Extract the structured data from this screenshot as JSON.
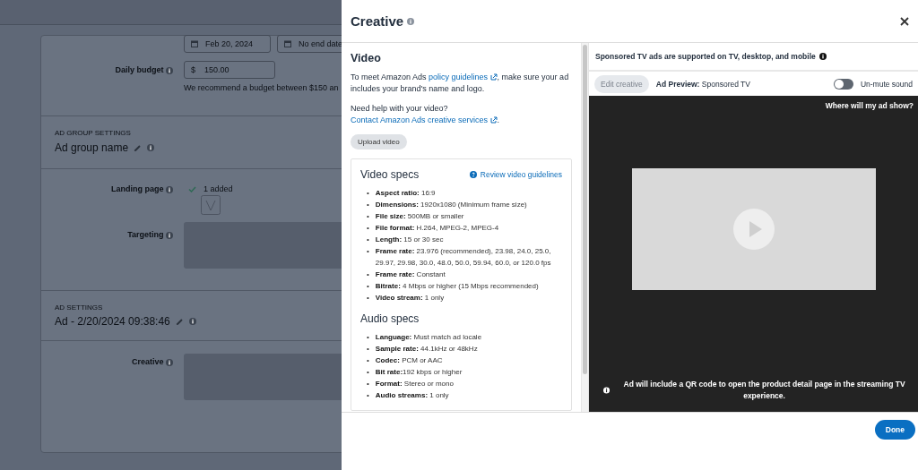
{
  "background": {
    "start_date": "Feb 20, 2024",
    "end_date": "No end date",
    "daily_budget": {
      "label": "Daily budget",
      "currency": "$",
      "value": "150.00",
      "hint": "We recommend a budget between $150 an"
    },
    "ad_group": {
      "section_label": "AD GROUP SETTINGS",
      "name": "Ad group name"
    },
    "landing_page": {
      "label": "Landing page",
      "status": "1 added"
    },
    "targeting": {
      "label": "Targeting"
    },
    "ad_settings": {
      "section_label": "AD SETTINGS",
      "name": "Ad - 2/20/2024 09:38:46"
    },
    "creative": {
      "label": "Creative"
    }
  },
  "modal": {
    "title": "Creative",
    "video": {
      "heading": "Video",
      "paragraphs": [
        [
          {
            "kind": "text",
            "text": "To meet Amazon Ads "
          },
          {
            "kind": "link",
            "text": "policy guidelines"
          },
          {
            "kind": "text",
            "text": ", make sure your ad includes your brand's name and logo."
          }
        ],
        [
          {
            "kind": "text",
            "text": "Need help with your video? "
          },
          {
            "kind": "link",
            "text": "Contact Amazon Ads creative services"
          },
          {
            "kind": "text",
            "text": "."
          }
        ]
      ],
      "upload_button": "Upload video"
    },
    "video_specs": {
      "heading": "Video specs",
      "link": "Review video guidelines",
      "bullet": "•",
      "items": [
        "**Aspect ratio:** 16:9",
        "**Dimensions:** 1920x1080 (Minimum frame size)",
        "**File size:** 500MB or smaller",
        "**File format:** H.264, MPEG-2, MPEG-4",
        "**Length:** 15 or 30 sec",
        "**Frame rate:** 23.976 (recommended), 23.98, 24.0, 25.0, 29.97, 29.98, 30.0, 48.0, 50.0, 59.94, 60.0, or 120.0 fps",
        "**Frame rate:** Constant",
        "**Bitrate:** 4 Mbps or higher (15 Mbps recommended)",
        "**Video stream:** 1 only"
      ]
    },
    "audio_specs": {
      "heading": "Audio specs",
      "bullet": "•",
      "items": [
        "**Language:** Must match ad locale",
        "**Sample rate:** 44.1kHz or 48kHz",
        "**Codec:** PCM or AAC",
        "**Bit rate:**192 kbps or higher",
        "**Format:** Stereo or mono",
        "**Audio streams:** 1 only"
      ]
    },
    "preview": {
      "notice": "Sponsored TV ads are supported on TV, desktop, and mobile",
      "edit_button": {
        "label": "Edit creative",
        "disabled": true
      },
      "preview_label": "Ad Preview:",
      "preview_value": "Sponsored TV",
      "sound_toggle": {
        "label": "Un-mute sound",
        "on": false
      },
      "where_link": "Where will my ad show?",
      "qr_notice": "Ad will include a QR code to open the product detail page in the streaming TV experience."
    },
    "done_button": "Done"
  }
}
